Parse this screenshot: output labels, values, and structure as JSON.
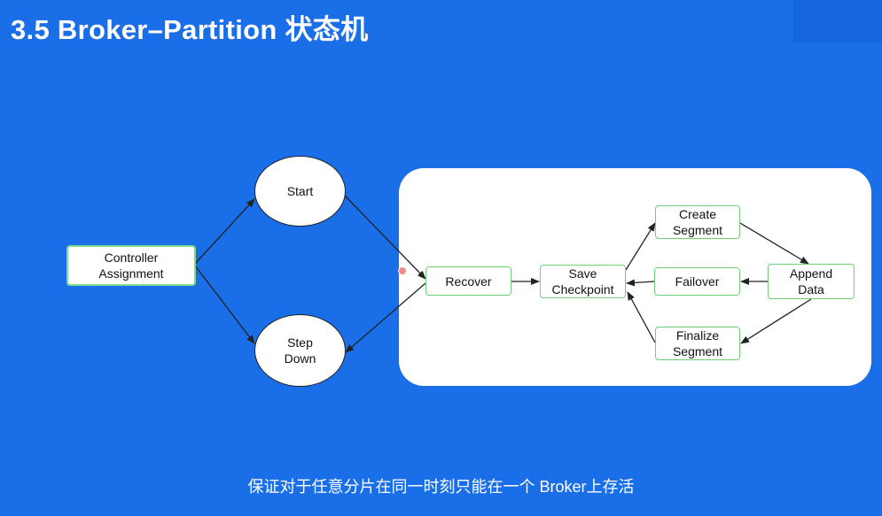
{
  "slide": {
    "title": "3.5 Broker–Partition 状态机",
    "subtitle": "保证对于任意分片在同一时刻只能在一个 Broker上存活"
  },
  "nodes": {
    "controller": "Controller\nAssignment",
    "start": "Start",
    "step_down": "Step\nDown",
    "recover": "Recover",
    "save_checkpoint": "Save\nCheckpoint",
    "create_segment": "Create\nSegment",
    "failover": "Failover",
    "finalize_segment": "Finalize\nSegment",
    "append_data": "Append\nData"
  },
  "colors": {
    "background": "#1a6ee8",
    "panel": "#ffffff",
    "box_border": "#6fcf7a",
    "arrow": "#222222"
  }
}
